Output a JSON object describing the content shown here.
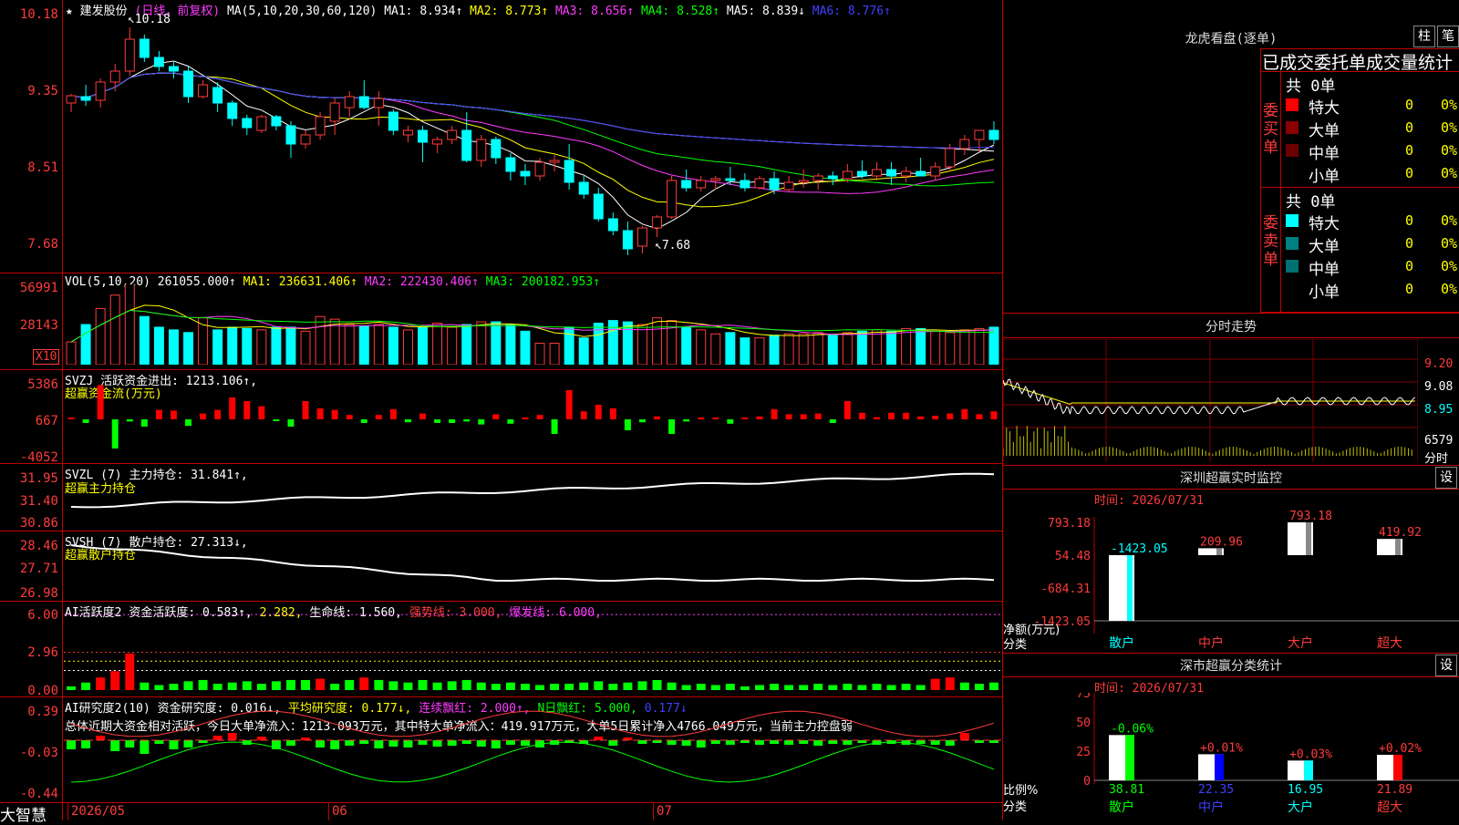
{
  "header": {
    "star": "★",
    "stock_name": "建发股份",
    "period": "(日线，前复权)",
    "ma_label": "MA(5,10,20,30,60,120)",
    "ma1": "MA1: 8.934↑",
    "ma2": "MA2: 8.773↑",
    "ma3": "MA3: 8.656↑",
    "ma4": "MA4: 8.528↑",
    "ma5": "MA5: 8.839↓",
    "ma6": "MA6: 8.776↑",
    "high_mark": "10.18",
    "low_mark": "7.68"
  },
  "price_axis": [
    "10.18",
    "9.35",
    "8.51",
    "7.68"
  ],
  "vol": {
    "title": "VOL(5,10,20)",
    "value": "261055.000↑",
    "ma1": "MA1: 236631.406↑",
    "ma2": "MA2: 222430.406↑",
    "ma3": "MA3: 200182.953↑",
    "axis": [
      "56991",
      "28143"
    ],
    "unit": "X10"
  },
  "svzj": {
    "title": "SVZJ",
    "desc": "活跃资金进出: 1213.106↑,",
    "sub": "超赢资金流(万元)",
    "axis": [
      "5386",
      "667",
      "-4052"
    ]
  },
  "svzl": {
    "title": "SVZL (7)",
    "desc": "主力持仓: 31.841↑,",
    "sub": "超赢主力持仓",
    "axis": [
      "31.95",
      "31.40",
      "30.86"
    ]
  },
  "svsh": {
    "title": "SVSH (7)",
    "desc": "散户持仓: 27.313↓,",
    "sub": "超赢散户持仓",
    "axis": [
      "28.46",
      "27.71",
      "26.98"
    ]
  },
  "ai1": {
    "title": "AI活跃度2",
    "desc": "资金活跃度: 0.583↑,",
    "v2": "2.282,",
    "life": "生命线: 1.560,",
    "strong": "强势线: 3.000,",
    "burst": "爆发线: 6.000,",
    "axis": [
      "6.00",
      "2.96",
      "0.00"
    ]
  },
  "ai2": {
    "title": "AI研究度2(10)",
    "desc": "资金研究度: 0.016↓,",
    "avg": "平均研究度: 0.177↓,",
    "red": "连续飘红: 2.000↑,",
    "nred": "N日飘红: 5.000,",
    "v": "0.177↓",
    "summary": "总体近期大资金相对活跃，今日大单净流入：1213.093万元，其中特大单净流入：419.917万元，大单5日累计净入4766.049万元，当前主力控盘弱",
    "axis": [
      "0.39",
      "-0.03",
      "-0.44"
    ]
  },
  "xaxis": {
    "brand": "大智慧",
    "d1": "2026/05",
    "d2": "06",
    "d3": "07"
  },
  "lhb": {
    "title": "龙虎看盘(逐单)",
    "btn1": "柱",
    "btn2": "笔",
    "stats_title": "已成交委托单成交量统计",
    "buy_label": "委买单",
    "sell_label": "委卖单",
    "buy_total": "共 0单",
    "sell_total": "共 0单",
    "rows": [
      "特大",
      "大单",
      "中单",
      "小单"
    ],
    "zero": "0",
    "pct": "0%",
    "buy_colors": [
      "#ff0000",
      "#8b0000",
      "#6b0000",
      "#000000"
    ],
    "sell_colors": [
      "#00ffff",
      "#008080",
      "#007070",
      "#000000"
    ]
  },
  "fenshi": {
    "title": "分时走势",
    "p1": "9.20",
    "p2": "9.08",
    "p3": "8.95",
    "vol": "6579",
    "unit": "分时"
  },
  "monitor": {
    "title": "深圳超赢实时监控",
    "btn": "设",
    "time": "时间: 2026/07/31",
    "axis": [
      "793.18",
      "54.48",
      "-684.31",
      "-1423.05"
    ],
    "ylabel": "净额(万元)",
    "xlabel": "分类",
    "cats": [
      "散户",
      "中户",
      "大户",
      "超大"
    ],
    "values": [
      "-1423.05",
      "209.96",
      "793.18",
      "419.92"
    ]
  },
  "classify": {
    "title": "深市超赢分类统计",
    "btn": "设",
    "time": "时间: 2026/07/31",
    "axis": [
      "75",
      "50",
      "25",
      "0"
    ],
    "ylabel": "比例%",
    "xlabel": "分类",
    "cats": [
      "散户",
      "中户",
      "大户",
      "超大"
    ],
    "top": [
      "-0.06%",
      "+0.01%",
      "+0.03%",
      "+0.02%"
    ],
    "values": [
      "38.81",
      "22.35",
      "16.95",
      "21.89"
    ]
  },
  "chart_data": {
    "type": "candlestick",
    "candles": [
      [
        9.35,
        9.45,
        9.25,
        9.43
      ],
      [
        9.42,
        9.55,
        9.32,
        9.38
      ],
      [
        9.38,
        9.62,
        9.3,
        9.58
      ],
      [
        9.58,
        9.78,
        9.48,
        9.7
      ],
      [
        9.7,
        10.18,
        9.65,
        10.05
      ],
      [
        10.05,
        10.1,
        9.8,
        9.85
      ],
      [
        9.85,
        9.92,
        9.7,
        9.75
      ],
      [
        9.75,
        9.8,
        9.62,
        9.7
      ],
      [
        9.7,
        9.75,
        9.35,
        9.42
      ],
      [
        9.42,
        9.6,
        9.4,
        9.55
      ],
      [
        9.52,
        9.58,
        9.25,
        9.35
      ],
      [
        9.35,
        9.38,
        9.1,
        9.18
      ],
      [
        9.18,
        9.22,
        9.0,
        9.08
      ],
      [
        9.05,
        9.22,
        9.02,
        9.2
      ],
      [
        9.2,
        9.22,
        9.05,
        9.1
      ],
      [
        9.1,
        9.15,
        8.75,
        8.9
      ],
      [
        8.9,
        9.05,
        8.85,
        9.0
      ],
      [
        9.0,
        9.25,
        8.95,
        9.2
      ],
      [
        9.15,
        9.4,
        9.0,
        9.35
      ],
      [
        9.3,
        9.48,
        9.2,
        9.42
      ],
      [
        9.42,
        9.6,
        9.28,
        9.3
      ],
      [
        9.3,
        9.48,
        9.1,
        9.4
      ],
      [
        9.25,
        9.28,
        9.0,
        9.05
      ],
      [
        9.0,
        9.1,
        8.92,
        9.05
      ],
      [
        9.05,
        9.1,
        8.7,
        8.92
      ],
      [
        8.9,
        8.98,
        8.8,
        8.95
      ],
      [
        8.95,
        9.1,
        8.9,
        9.05
      ],
      [
        9.05,
        9.25,
        8.7,
        8.72
      ],
      [
        8.72,
        9.0,
        8.65,
        8.95
      ],
      [
        8.95,
        8.98,
        8.68,
        8.75
      ],
      [
        8.75,
        8.8,
        8.5,
        8.6
      ],
      [
        8.6,
        8.68,
        8.45,
        8.55
      ],
      [
        8.55,
        8.75,
        8.5,
        8.7
      ],
      [
        8.7,
        8.78,
        8.6,
        8.72
      ],
      [
        8.72,
        8.9,
        8.4,
        8.48
      ],
      [
        8.48,
        8.55,
        8.3,
        8.35
      ],
      [
        8.35,
        8.42,
        8.05,
        8.08
      ],
      [
        8.08,
        8.15,
        7.9,
        7.95
      ],
      [
        7.95,
        8.05,
        7.68,
        7.75
      ],
      [
        7.78,
        8.0,
        7.7,
        7.98
      ],
      [
        7.98,
        8.12,
        7.88,
        8.1
      ],
      [
        8.1,
        8.55,
        8.08,
        8.5
      ],
      [
        8.5,
        8.62,
        8.38,
        8.42
      ],
      [
        8.42,
        8.55,
        8.38,
        8.5
      ],
      [
        8.5,
        8.55,
        8.4,
        8.52
      ],
      [
        8.52,
        8.65,
        8.45,
        8.5
      ],
      [
        8.5,
        8.58,
        8.38,
        8.42
      ],
      [
        8.42,
        8.55,
        8.4,
        8.52
      ],
      [
        8.52,
        8.6,
        8.35,
        8.4
      ],
      [
        8.4,
        8.55,
        8.38,
        8.48
      ],
      [
        8.48,
        8.62,
        8.42,
        8.5
      ],
      [
        8.5,
        8.58,
        8.4,
        8.55
      ],
      [
        8.55,
        8.6,
        8.45,
        8.52
      ],
      [
        8.52,
        8.68,
        8.48,
        8.6
      ],
      [
        8.6,
        8.72,
        8.52,
        8.55
      ],
      [
        8.55,
        8.7,
        8.5,
        8.62
      ],
      [
        8.62,
        8.7,
        8.45,
        8.55
      ],
      [
        8.55,
        8.65,
        8.48,
        8.6
      ],
      [
        8.6,
        8.75,
        8.55,
        8.55
      ],
      [
        8.55,
        8.7,
        8.5,
        8.65
      ],
      [
        8.65,
        8.9,
        8.6,
        8.85
      ],
      [
        8.85,
        9.0,
        8.78,
        8.95
      ],
      [
        8.95,
        9.05,
        8.82,
        9.05
      ],
      [
        9.05,
        9.15,
        8.9,
        8.95
      ]
    ],
    "volume": [
      17,
      30,
      42,
      52,
      62,
      36,
      28,
      26,
      24,
      35,
      26,
      28,
      27,
      26,
      28,
      28,
      25,
      36,
      34,
      30,
      29,
      30,
      28,
      26,
      28,
      31,
      28,
      30,
      32,
      32,
      30,
      25,
      16,
      16,
      28,
      20,
      31,
      33,
      32,
      30,
      35,
      33,
      28,
      26,
      23,
      24,
      20,
      20,
      22,
      23,
      23,
      24,
      22,
      24,
      25,
      26,
      25,
      27,
      27,
      25,
      24,
      26,
      27,
      28
    ],
    "svzj": [
      0,
      -0.5,
      4.7,
      -4,
      -0.3,
      -1,
      1.3,
      1.2,
      -0.9,
      0.8,
      1.3,
      3,
      2.5,
      1.8,
      -0.2,
      -1,
      2.5,
      1.5,
      1.3,
      0.6,
      -0.5,
      0.6,
      1.4,
      -0.4,
      0.8,
      -0.5,
      -0.5,
      -0.3,
      -0.7,
      0.7,
      -0.6,
      0.2,
      0.6,
      -2,
      4,
      1.1,
      2,
      1.5,
      -1.5,
      -0.4,
      0.4,
      -2,
      -0.3,
      0.2,
      0.2,
      -0.6,
      0.2,
      0.4,
      1.4,
      0.7,
      0.7,
      0.8,
      -0.5,
      2.5,
      0.9,
      0.3,
      0.9,
      0.9,
      0.4,
      0.5,
      0.8,
      1.4,
      0.7,
      1.1
    ],
    "ai1": [
      0.3,
      0.6,
      1,
      1.5,
      2.9,
      0.6,
      0.4,
      0.5,
      0.7,
      0.8,
      0.5,
      0.6,
      0.7,
      0.5,
      0.7,
      0.8,
      0.8,
      0.9,
      0.5,
      0.8,
      1,
      0.8,
      0.7,
      0.6,
      0.8,
      0.6,
      0.7,
      0.8,
      0.6,
      0.5,
      0.6,
      0.5,
      0.4,
      0.5,
      0.5,
      0.6,
      0.7,
      0.5,
      0.6,
      0.7,
      0.8,
      0.6,
      0.4,
      0.5,
      0.4,
      0.5,
      0.3,
      0.4,
      0.5,
      0.4,
      0.4,
      0.5,
      0.4,
      0.5,
      0.4,
      0.5,
      0.4,
      0.5,
      0.4,
      0.9,
      1,
      0.6,
      0.5,
      0.6
    ],
    "ai2": [
      -0.1,
      -0.09,
      0.05,
      -0.12,
      -0.08,
      -0.15,
      -0.04,
      -0.1,
      -0.08,
      -0.03,
      0.05,
      0.08,
      -0.05,
      0.04,
      -0.1,
      -0.06,
      0.03,
      -0.08,
      -0.1,
      -0.06,
      -0.04,
      -0.09,
      -0.07,
      -0.08,
      -0.05,
      -0.07,
      -0.06,
      -0.04,
      -0.07,
      -0.09,
      -0.05,
      -0.06,
      -0.08,
      -0.05,
      -0.03,
      -0.04,
      0.04,
      -0.06,
      0.03,
      -0.04,
      -0.03,
      -0.05,
      -0.06,
      -0.08,
      -0.04,
      -0.05,
      -0.03,
      -0.05,
      -0.04,
      -0.05,
      -0.04,
      -0.06,
      -0.04,
      -0.05,
      -0.03,
      -0.05,
      -0.04,
      -0.05,
      -0.04,
      -0.05,
      -0.06,
      0.08,
      -0.03,
      -0.02
    ]
  }
}
